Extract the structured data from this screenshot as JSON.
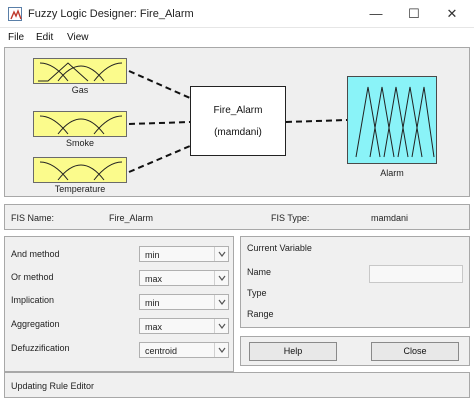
{
  "window": {
    "title": "Fuzzy Logic Designer: Fire_Alarm",
    "minimize": "—",
    "maximize": "☐",
    "close": "✕"
  },
  "menu": [
    "File",
    "Edit",
    "View"
  ],
  "diagram": {
    "inputs": [
      "Gas",
      "Smoke",
      "Temperature"
    ],
    "system_name": "Fire_Alarm",
    "system_type": "(mamdani)",
    "output": "Alarm",
    "colors": {
      "input": "#fbfb8c",
      "output": "#8af3f8"
    }
  },
  "fis_info": {
    "name_label": "FIS Name:",
    "name_value": "Fire_Alarm",
    "type_label": "FIS Type:",
    "type_value": "mamdani"
  },
  "methods": [
    {
      "label": "And method",
      "value": "min"
    },
    {
      "label": "Or method",
      "value": "max"
    },
    {
      "label": "Implication",
      "value": "min"
    },
    {
      "label": "Aggregation",
      "value": "max"
    },
    {
      "label": "Defuzzification",
      "value": "centroid"
    }
  ],
  "current_variable": {
    "title": "Current Variable",
    "name_label": "Name",
    "type_label": "Type",
    "range_label": "Range",
    "name_value": ""
  },
  "buttons": {
    "help": "Help",
    "close": "Close"
  },
  "status": "Updating Rule Editor"
}
